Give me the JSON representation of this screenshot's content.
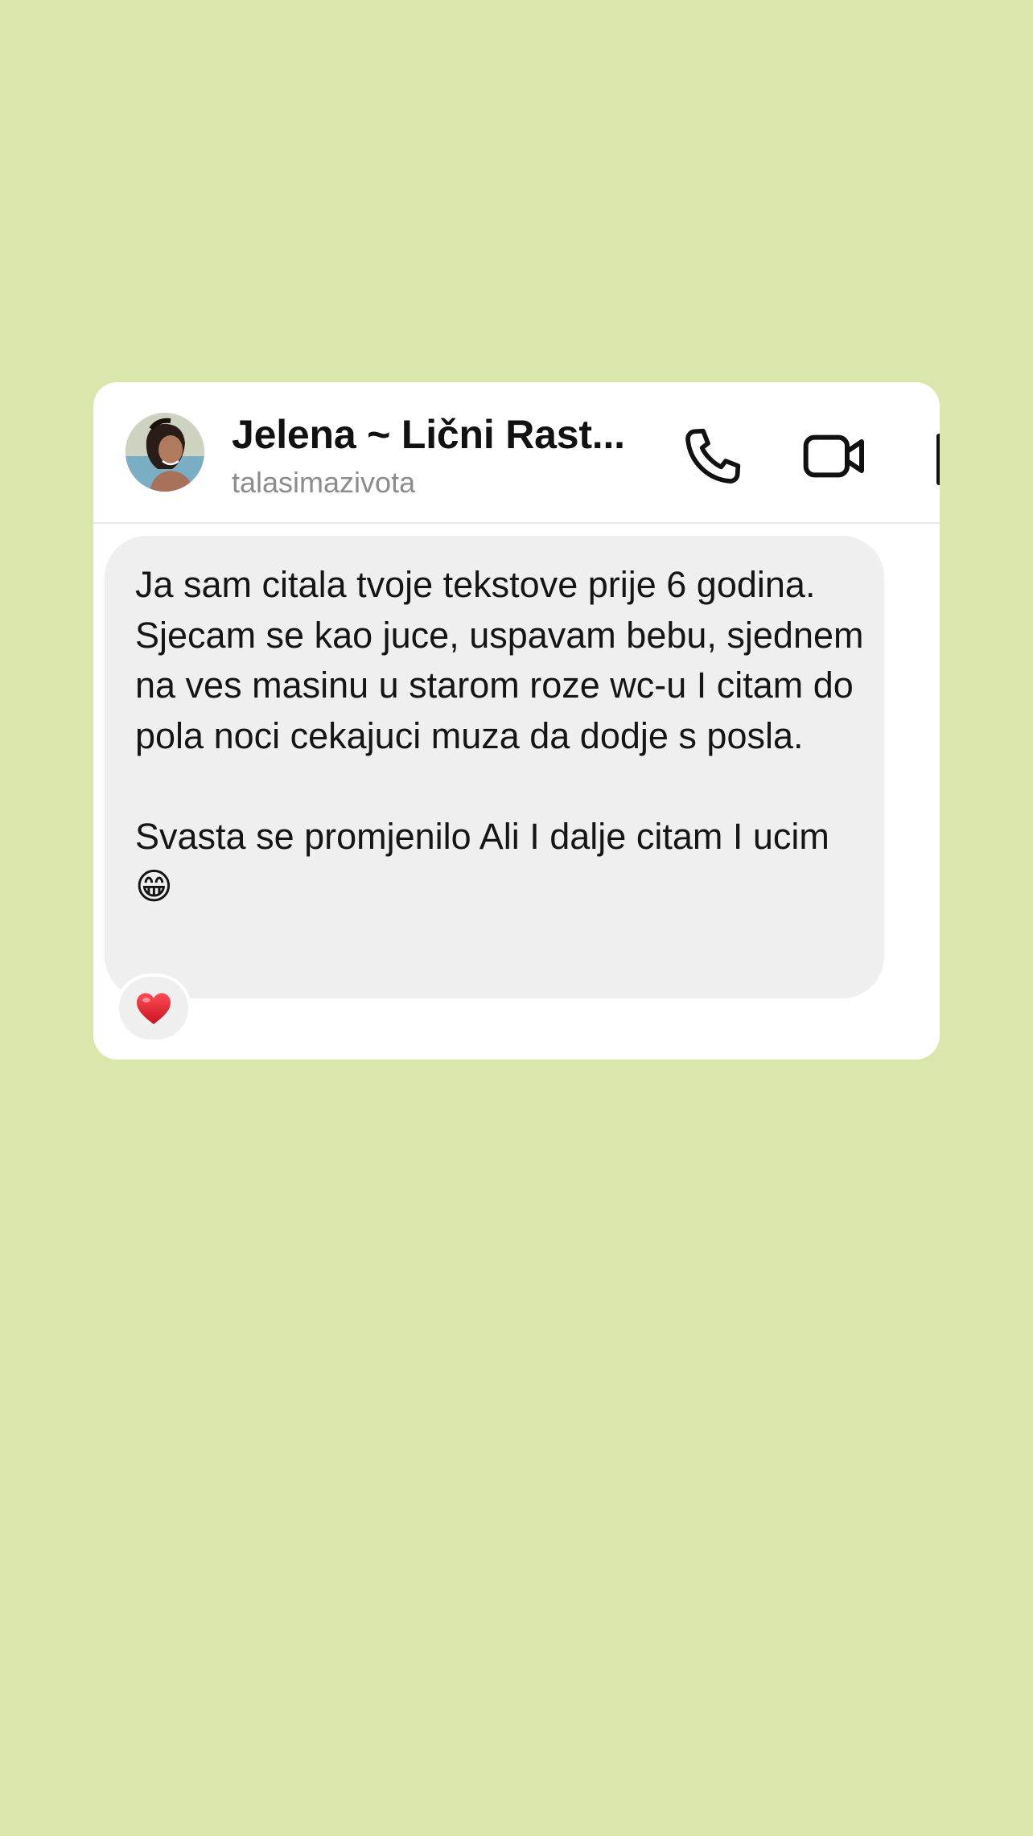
{
  "header": {
    "contact_name": "Jelena ~ Lični Rast...",
    "username": "talasimazivota",
    "icons": {
      "avatar": "profile-photo",
      "call": "phone-icon",
      "video": "video-camera-icon",
      "more": "more-icon"
    }
  },
  "message": {
    "text": "Ja sam citala tvoje tekstove prije 6 godina. Sjecam se kao juce, uspavam bebu, sjednem na ves masinu u starom roze wc-u I citam do pola noci cekajuci muza da dodje s posla.\n\nSvasta se promjenilo Ali I dalje citam I ucim 😁",
    "reaction": "heart",
    "reaction_icon": "heart-icon"
  },
  "colors": {
    "background": "#d9e7ad",
    "card": "#ffffff",
    "bubble": "#efefef",
    "reaction_heart": "#e0242f"
  }
}
